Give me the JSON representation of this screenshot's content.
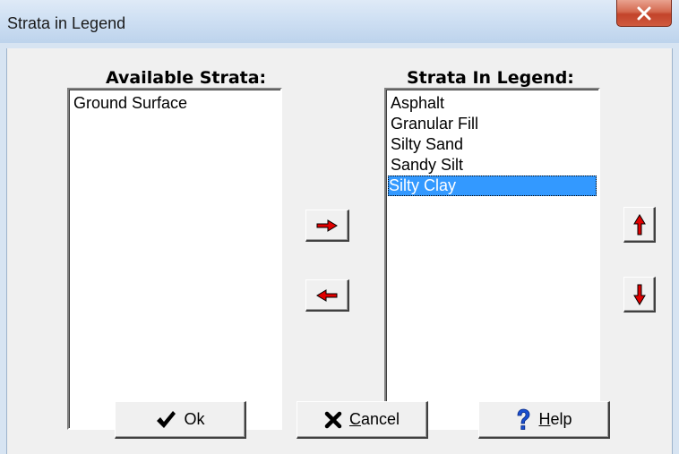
{
  "window": {
    "title": "Strata in Legend"
  },
  "available": {
    "header": "Available Strata:",
    "items": [
      "Ground Surface"
    ]
  },
  "legend": {
    "header": "Strata In Legend:",
    "items": [
      "Asphalt",
      "Granular Fill",
      "Silty Sand",
      "Sandy Silt",
      "Silty Clay"
    ],
    "selected": "Silty Clay"
  },
  "buttons": {
    "ok_label": "Ok",
    "cancel_prefix": "X",
    "cancel_label": "Cancel",
    "help_label": "Help"
  },
  "icons": {
    "move_right": "arrow-right-icon",
    "move_left": "arrow-left-icon",
    "move_up": "arrow-up-icon",
    "move_down": "arrow-down-icon",
    "ok": "checkmark-icon",
    "cancel": "x-icon",
    "help": "question-mark-icon",
    "close": "close-icon"
  },
  "colors": {
    "selection": "#3399ff",
    "arrow": "#e00000",
    "close_button": "#c2432a",
    "help_icon": "#1a4fd0"
  }
}
